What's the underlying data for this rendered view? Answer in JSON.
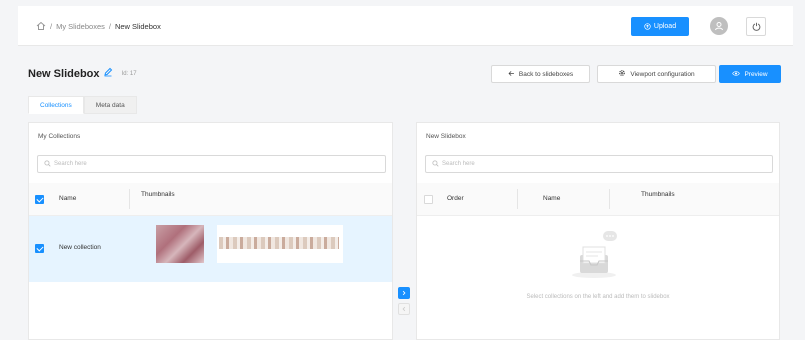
{
  "header": {
    "breadcrumb": [
      "My Slideboxes",
      "New Slidebox"
    ],
    "separator": "/",
    "upload_label": "Upload",
    "icons": {
      "home": "home-icon",
      "upload": "upload-icon",
      "avatar": "user-icon",
      "logout": "logout-icon"
    }
  },
  "page": {
    "title": "New Slidebox",
    "id_text": "Id: 17",
    "actions": {
      "back": "Back to slideboxes",
      "viewport": "Viewport configuration",
      "preview": "Preview"
    }
  },
  "tabs": [
    {
      "label": "Collections",
      "active": true
    },
    {
      "label": "Meta data",
      "active": false
    }
  ],
  "left_panel": {
    "title": "My Collections",
    "search_placeholder": "Search here",
    "columns": [
      "Name",
      "Thumbnails"
    ],
    "rows": [
      {
        "name": "New collection",
        "checked": true
      }
    ]
  },
  "right_panel": {
    "title": "New Slidebox",
    "search_placeholder": "Search here",
    "columns": [
      "Order",
      "Name",
      "Thumbnails"
    ],
    "empty_text": "Select collections on the left and add them to slidebox"
  },
  "colors": {
    "accent": "#1890ff",
    "selected_row": "#e6f4ff"
  }
}
